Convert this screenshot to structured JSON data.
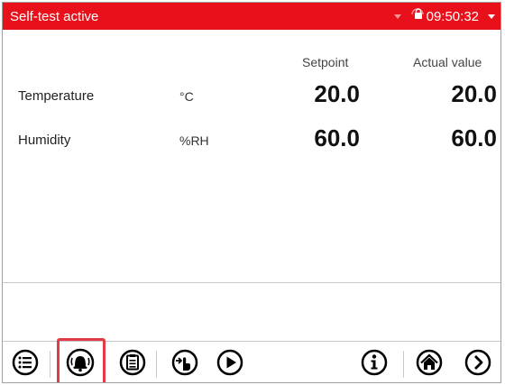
{
  "statusbar": {
    "message": "Self-test active",
    "time": "09:50:32",
    "background": "#e8101a"
  },
  "table": {
    "headers": {
      "setpoint": "Setpoint",
      "actual": "Actual value"
    },
    "rows": [
      {
        "label": "Temperature",
        "unit": "°C",
        "setpoint": "20.0",
        "actual": "20.0"
      },
      {
        "label": "Humidity",
        "unit": "%RH",
        "setpoint": "60.0",
        "actual": "60.0"
      }
    ]
  },
  "toolbar": {
    "buttons": [
      "menu-icon",
      "alarm-bell-icon",
      "clipboard-icon",
      "touch-hand-icon",
      "play-icon",
      "info-icon",
      "home-icon",
      "next-arrow-icon"
    ],
    "highlighted": "alarm-bell-icon",
    "highlight_color": "#e23a46"
  }
}
